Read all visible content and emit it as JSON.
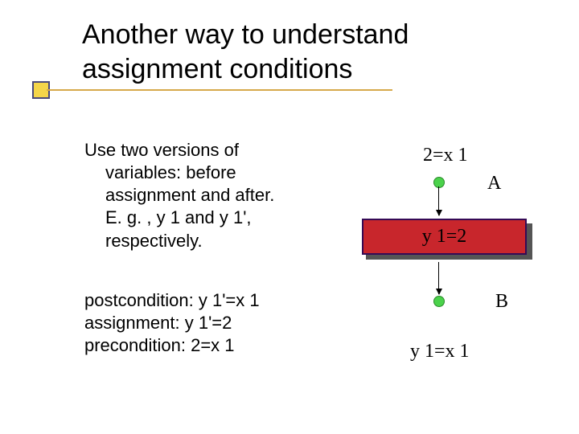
{
  "title": {
    "line1": "Another way to understand",
    "line2": "assignment conditions"
  },
  "left": {
    "para1_l1": "Use two versions of",
    "para1_l2": "variables: before",
    "para1_l3": "assignment and after.",
    "para1_l4": "E. g. , y 1 and y 1',",
    "para1_l5": "respectively.",
    "para2_l1": "postcondition: y 1'=x 1",
    "para2_l2": "assignment: y 1'=2",
    "para2_l3": "precondition: 2=x 1"
  },
  "diagram": {
    "top": "2=x 1",
    "letterA": "A",
    "letterB": "B",
    "box": "y 1=2",
    "bottom": "y 1=x 1"
  }
}
